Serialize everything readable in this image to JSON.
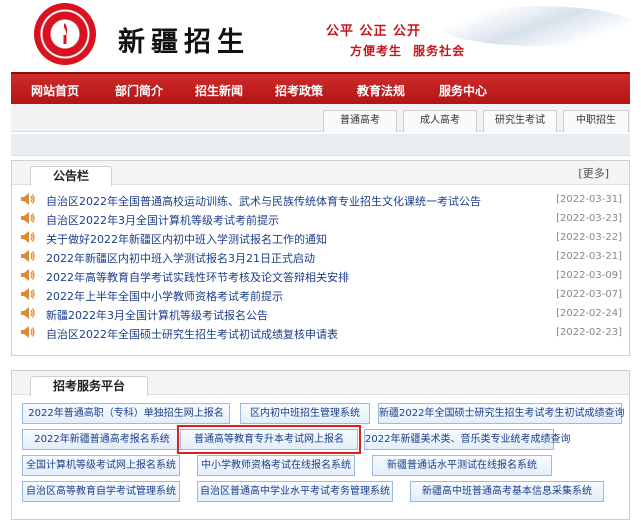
{
  "header": {
    "site_title": "新疆招生",
    "slogan_line1": "公平 公正 公开",
    "slogan_line2": "方便考生 服务社会"
  },
  "nav": {
    "items": [
      "网站首页",
      "部门简介",
      "招生新闻",
      "招考政策",
      "教育法规",
      "服务中心"
    ]
  },
  "subtabs": [
    "普通高考",
    "成人高考",
    "研究生考试",
    "中职招生"
  ],
  "notice_board": {
    "title": "公告栏",
    "more": "[更多]",
    "items": [
      {
        "title": "自治区2022年全国普通高校运动训练、武术与民族传统体育专业招生文化课统一考试公告",
        "date": "[2022-03-31]"
      },
      {
        "title": "自治区2022年3月全国计算机等级考试考前提示",
        "date": "[2022-03-23]"
      },
      {
        "title": "关于做好2022年新疆区内初中班入学测试报名工作的通知",
        "date": "[2022-03-22]"
      },
      {
        "title": "2022年新疆区内初中班入学测试报名3月21日正式启动",
        "date": "[2022-03-21]"
      },
      {
        "title": "2022年高等教育自学考试实践性环节考核及论文答辩相关安排",
        "date": "[2022-03-09]"
      },
      {
        "title": "2022年上半年全国中小学教师资格考试考前提示",
        "date": "[2022-03-07]"
      },
      {
        "title": "新疆2022年3月全国计算机等级考试报名公告",
        "date": "[2022-02-24]"
      },
      {
        "title": "自治区2022年全国硕士研究生招生考试初试成绩复核申请表",
        "date": "[2022-02-23]"
      }
    ]
  },
  "service_platform": {
    "title": "招考服务平台",
    "buttons": [
      "2022年普通高职（专科）单独招生网上报名",
      "区内初中班招生管理系统",
      "新疆2022年全国硕士研究生招生考试考生初试成绩查询",
      "2022年新疆普通高考报名系统",
      "普通高等教育专升本考试网上报名",
      "2022年新疆美术类、音乐类专业统考成绩查询",
      "全国计算机等级考试网上报名系统",
      "中小学教师资格考试在线报名系统",
      "新疆普通话水平测试在线报名系统",
      "自治区高等教育自学考试管理系统",
      "自治区普通高中学业水平考试考务管理系统",
      "新疆高中班普通高考基本信息采集系统"
    ]
  },
  "colors": {
    "nav_red": "#c4161c",
    "link_blue": "#1c3e8a",
    "highlight_red": "#e01e1e"
  }
}
